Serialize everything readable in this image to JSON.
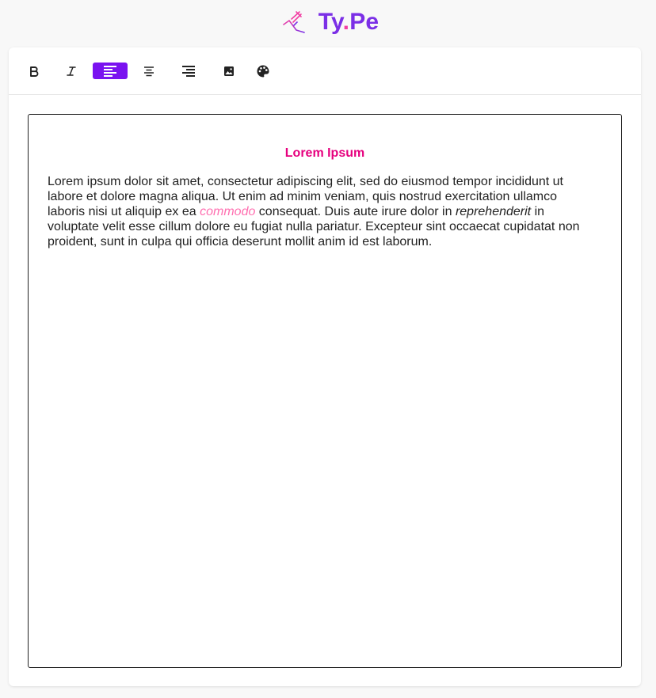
{
  "brand": {
    "name_part1": "Ty",
    "name_dot": ".",
    "name_part2": "Pe",
    "logo_icon": "pen-tool-icon"
  },
  "colors": {
    "brand_purple": "#7b2fe6",
    "brand_pink": "#f23fa3",
    "active_tool_bg": "#7a12f0",
    "title_pink": "#e6007e",
    "highlight_pink": "#ff6fb0"
  },
  "toolbar": {
    "tools": [
      {
        "name": "bold",
        "icon": "bold-icon",
        "active": false
      },
      {
        "name": "italic",
        "icon": "italic-icon",
        "active": false
      },
      {
        "name": "align-left",
        "icon": "align-left-icon",
        "active": true
      },
      {
        "name": "align-center",
        "icon": "align-center-icon",
        "active": false
      },
      {
        "name": "align-right",
        "icon": "align-right-icon",
        "active": false
      },
      {
        "name": "image",
        "icon": "image-icon",
        "active": false
      },
      {
        "name": "color",
        "icon": "palette-icon",
        "active": false
      }
    ]
  },
  "document": {
    "title": "Lorem Ipsum",
    "body": {
      "part1": "Lorem ipsum dolor sit amet, consectetur adipiscing elit, sed do eiusmod tempor incididunt ut labore et dolore magna aliqua. Ut enim ad minim veniam, quis nostrud exercitation ullamco laboris nisi ut aliquip ex ea ",
      "highlight1": "commodo",
      "part2": " consequat. Duis aute irure dolor in ",
      "italic1": "reprehenderit",
      "part3": " in voluptate velit esse cillum dolore eu fugiat nulla pariatur. Excepteur sint occaecat cupidatat non proident, sunt in culpa qui officia deserunt mollit anim id est laborum."
    }
  }
}
